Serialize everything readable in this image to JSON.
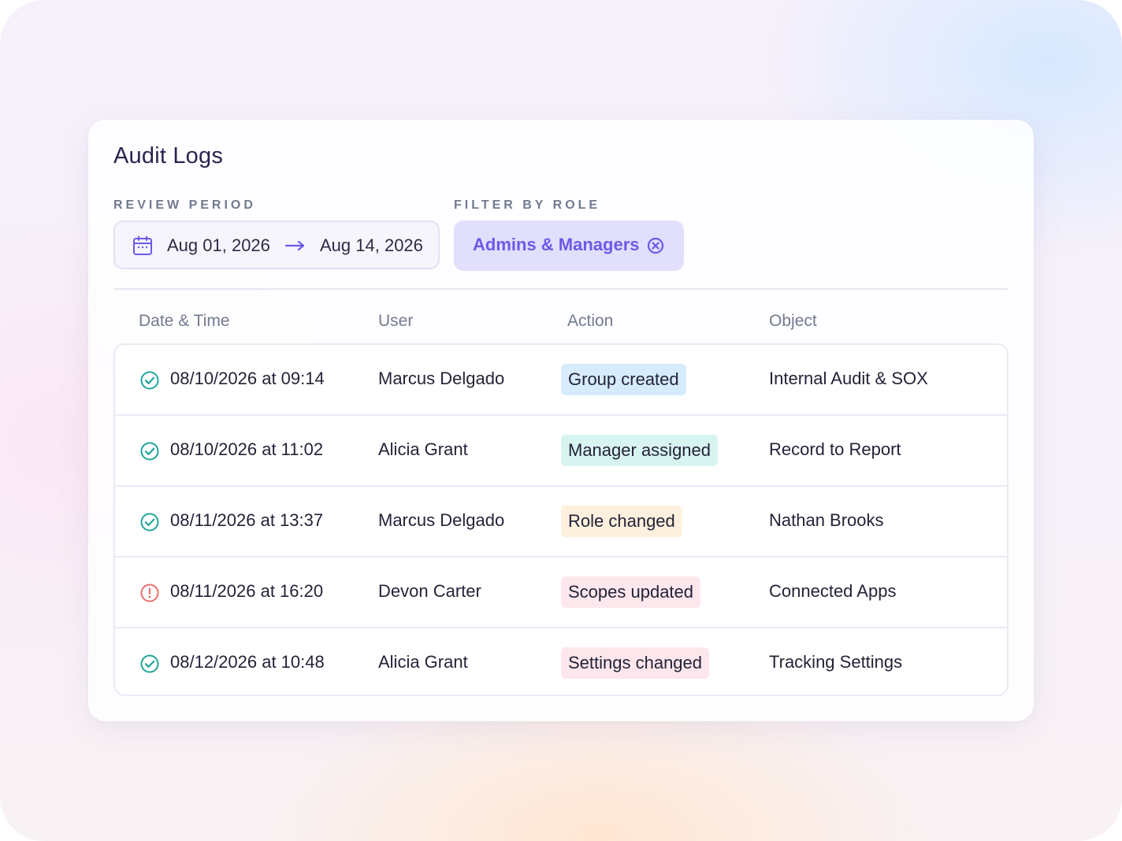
{
  "title": "Audit Logs",
  "filters": {
    "period_label": "REVIEW PERIOD",
    "start_date": "Aug 01, 2026",
    "end_date": "Aug 14, 2026",
    "role_label": "FILTER BY ROLE",
    "role_value": "Admins & Managers"
  },
  "table": {
    "headers": {
      "datetime": "Date & Time",
      "user": "User",
      "action": "Action",
      "object": "Object"
    },
    "rows": [
      {
        "status": "success",
        "datetime": "08/10/2026 at 09:14",
        "user": "Marcus Delgado",
        "action": "Group created",
        "action_color": "#d6ebfd",
        "object": "Internal Audit & SOX"
      },
      {
        "status": "success",
        "datetime": "08/10/2026 at 11:02",
        "user": "Alicia Grant",
        "action": "Manager assigned",
        "action_color": "#d8f4f1",
        "object": "Record to Report"
      },
      {
        "status": "success",
        "datetime": "08/11/2026 at 13:37",
        "user": "Marcus Delgado",
        "action": "Role changed",
        "action_color": "#fdf0de",
        "object": "Nathan Brooks"
      },
      {
        "status": "warning",
        "datetime": "08/11/2026 at 16:20",
        "user": "Devon Carter",
        "action": "Scopes updated",
        "action_color": "#fde7ec",
        "object": "Connected Apps"
      },
      {
        "status": "success",
        "datetime": "08/12/2026 at 10:48",
        "user": "Alicia Grant",
        "action": "Settings changed",
        "action_color": "#fde7ec",
        "object": "Tracking Settings"
      }
    ]
  },
  "colors": {
    "accent": "#6b5ae8",
    "success": "#1fa59a",
    "warning": "#ec6f6f"
  },
  "icons": {
    "calendar": "calendar-icon",
    "arrow": "arrow-right-icon",
    "clear": "clear-filter-icon",
    "success": "check-circle-icon",
    "warning": "alert-circle-icon"
  }
}
